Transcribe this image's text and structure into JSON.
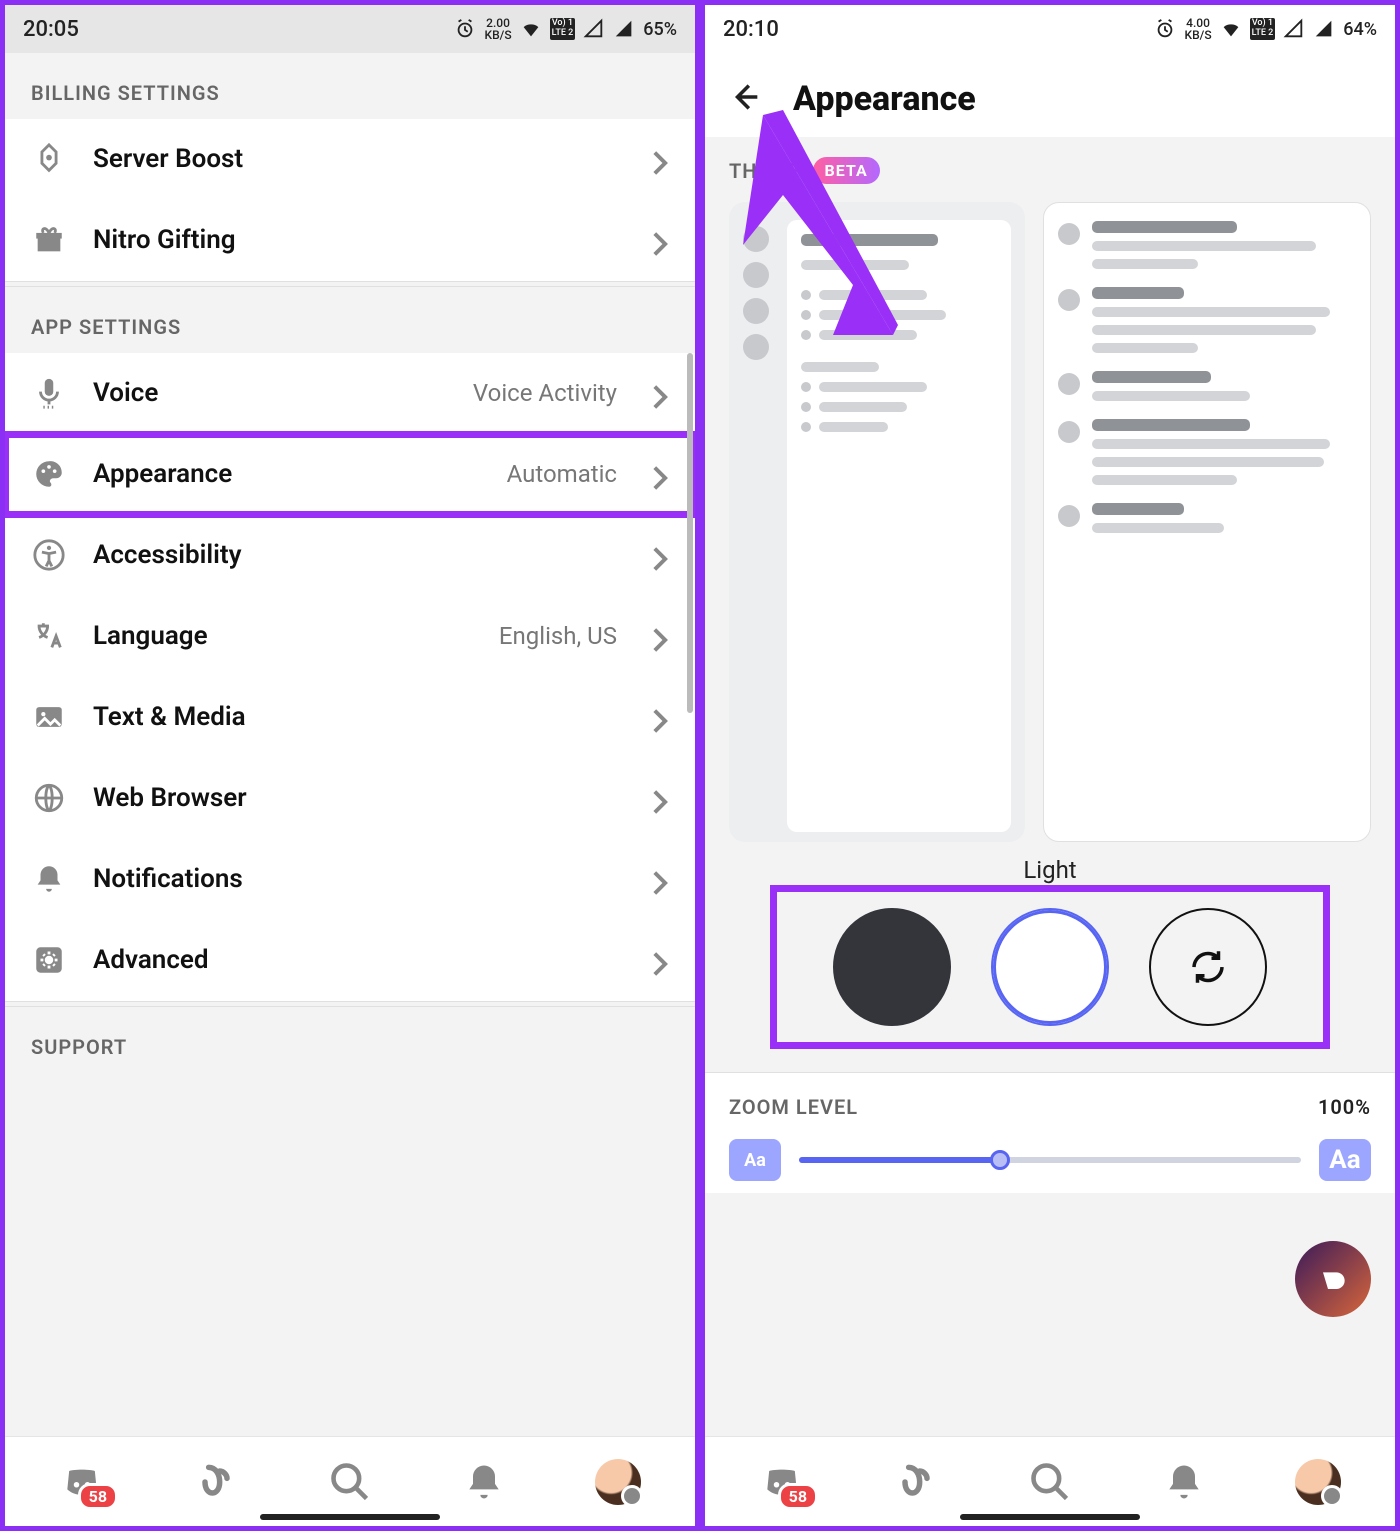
{
  "left": {
    "status": {
      "time": "20:05",
      "speed_top": "2.00",
      "speed_unit": "KB/S",
      "lte": "Vo) 1\nLTE 2",
      "battery": "65%"
    },
    "sections": {
      "billing_header": "BILLING SETTINGS",
      "app_header": "APP SETTINGS",
      "support_header": "SUPPORT"
    },
    "rows": {
      "server_boost": "Server Boost",
      "nitro_gifting": "Nitro Gifting",
      "voice": "Voice",
      "voice_value": "Voice Activity",
      "appearance": "Appearance",
      "appearance_value": "Automatic",
      "accessibility": "Accessibility",
      "language": "Language",
      "language_value": "English, US",
      "text_media": "Text & Media",
      "web_browser": "Web Browser",
      "notifications": "Notifications",
      "advanced": "Advanced"
    },
    "nav_badge": "58"
  },
  "right": {
    "status": {
      "time": "20:10",
      "speed_top": "4.00",
      "speed_unit": "KB/S",
      "lte": "Vo) 1\nLTE 2",
      "battery": "64%"
    },
    "title": "Appearance",
    "theme_header": "THEME",
    "beta": "BETA",
    "current_theme": "Light",
    "zoom_header": "ZOOM LEVEL",
    "zoom_value": "100%",
    "aa_small": "Aa",
    "aa_big": "Aa",
    "nav_badge": "58"
  }
}
